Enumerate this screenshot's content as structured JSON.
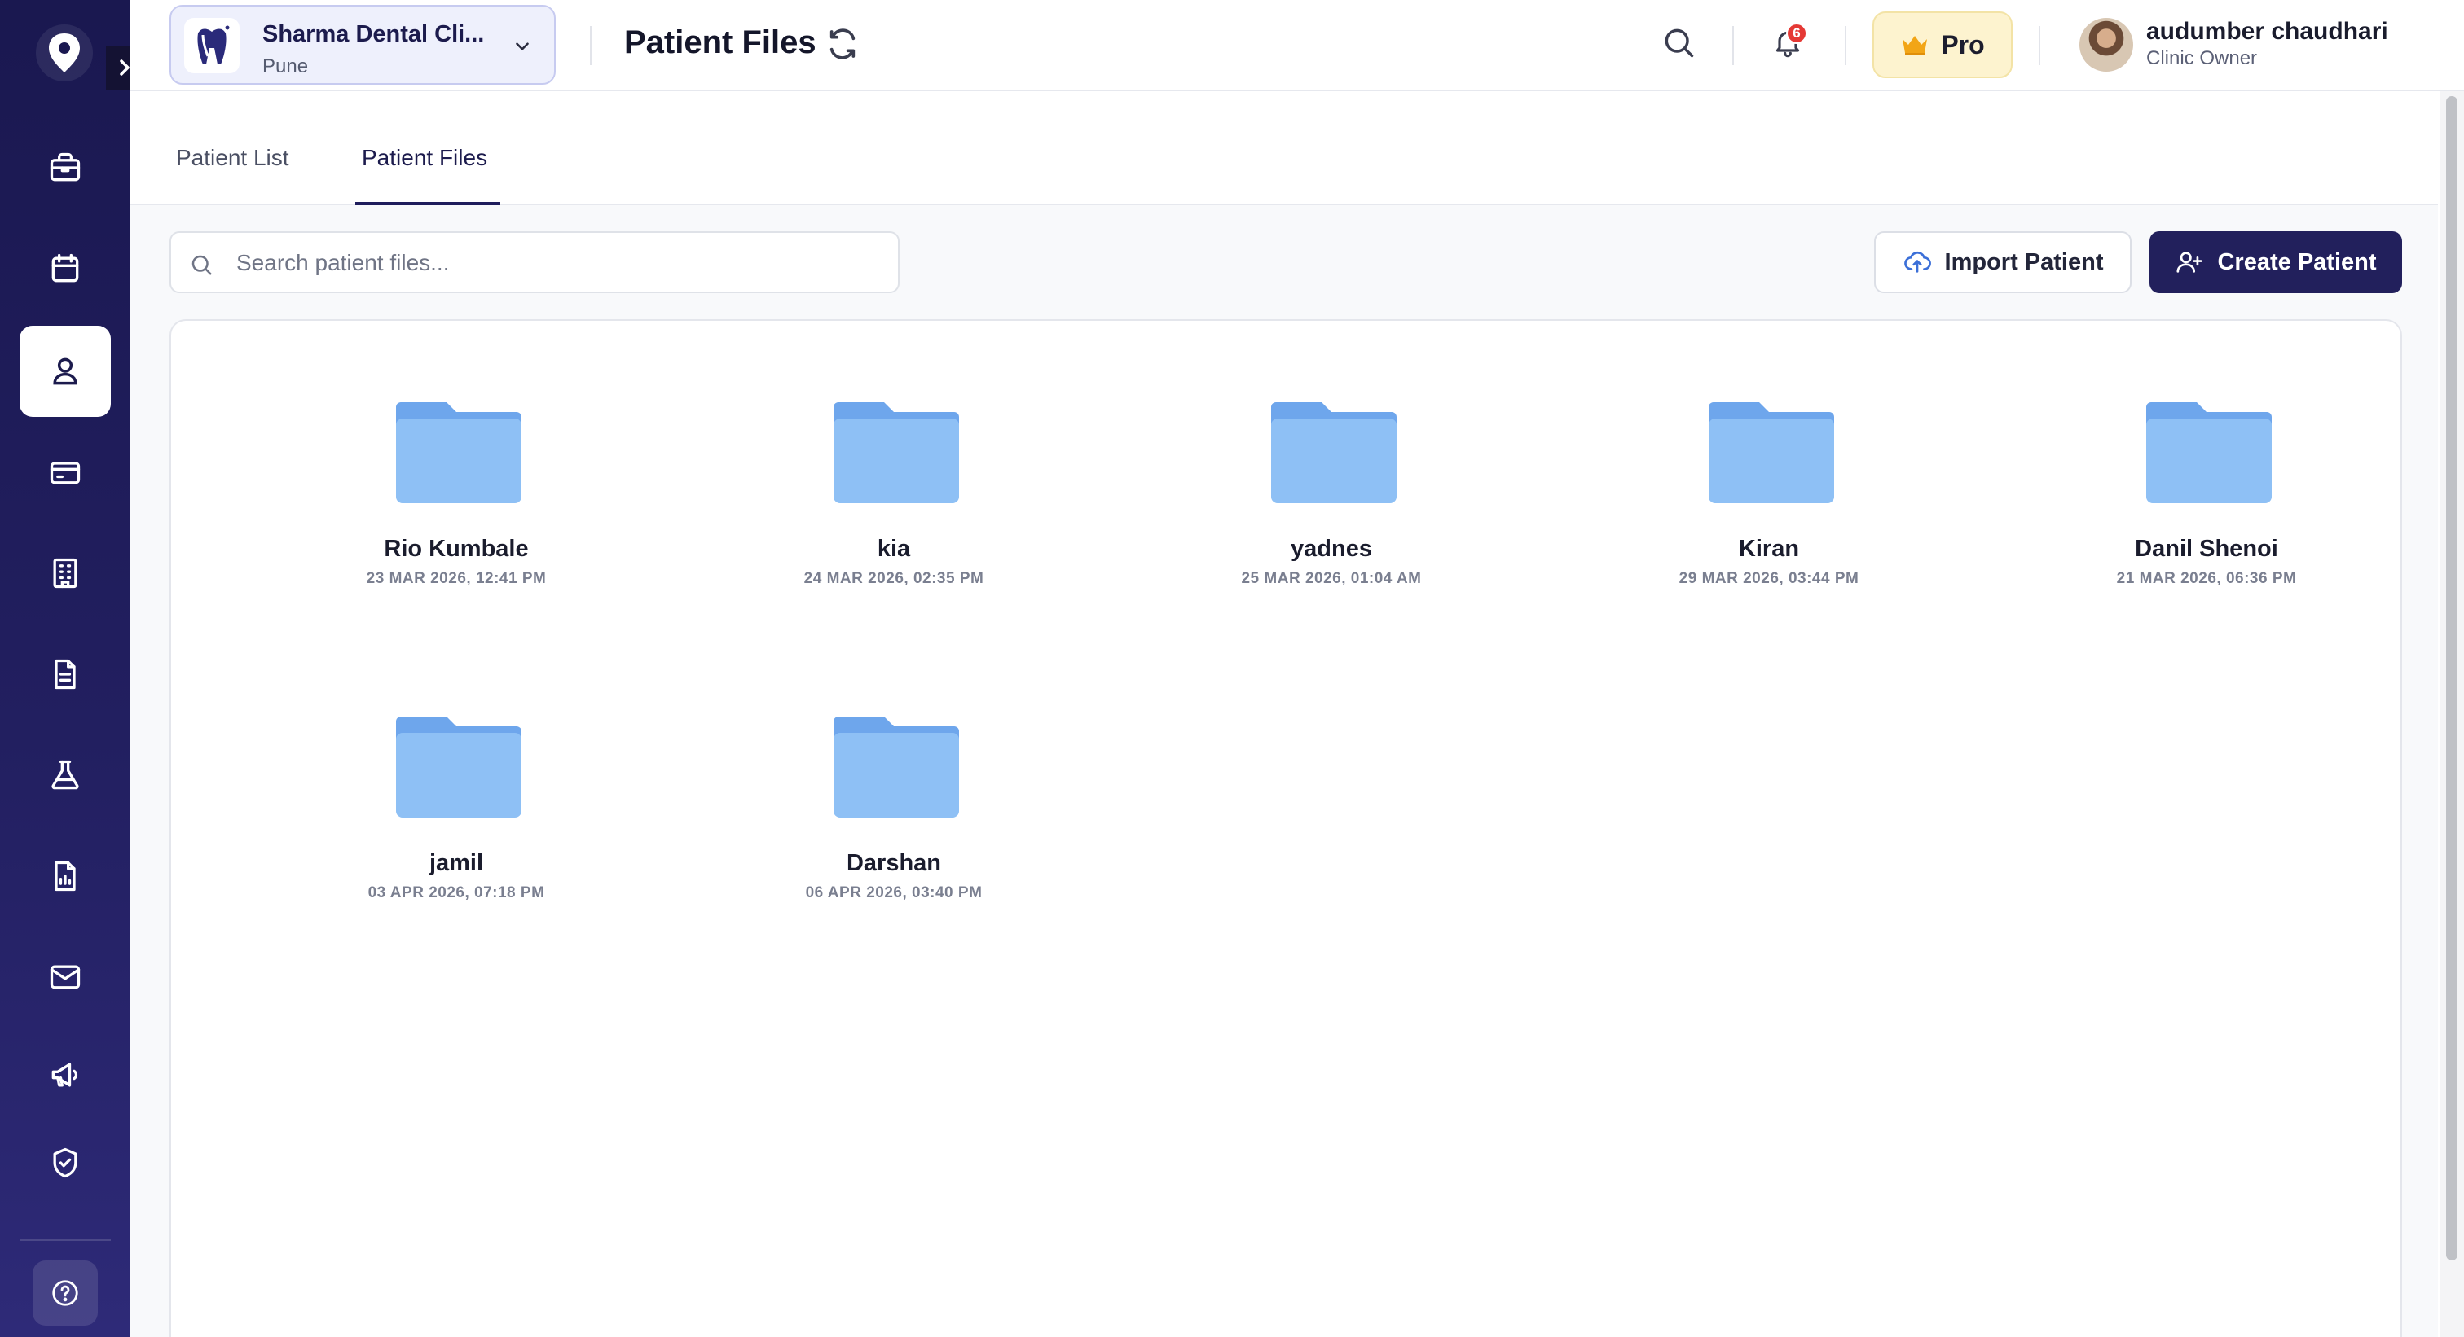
{
  "header": {
    "clinic_name": "Sharma Dental Cli...",
    "clinic_city": "Pune",
    "page_title": "Patient Files",
    "notification_count": "6",
    "pro_label": "Pro",
    "user_name": "audumber chaudhari",
    "user_role": "Clinic Owner"
  },
  "tabs": [
    {
      "label": "Patient List",
      "active": false
    },
    {
      "label": "Patient Files",
      "active": true
    }
  ],
  "search": {
    "placeholder": "Search patient files..."
  },
  "actions": {
    "import_label": "Import Patient",
    "create_label": "Create Patient"
  },
  "sidebar": {
    "items": [
      {
        "icon": "briefcase-icon",
        "active": false
      },
      {
        "icon": "calendar-icon",
        "active": false
      },
      {
        "icon": "user-icon",
        "active": true
      },
      {
        "icon": "billing-card-icon",
        "active": false
      },
      {
        "icon": "building-icon",
        "active": false
      },
      {
        "icon": "document-icon",
        "active": false
      },
      {
        "icon": "lab-flask-icon",
        "active": false
      },
      {
        "icon": "report-icon",
        "active": false
      },
      {
        "icon": "mail-icon",
        "active": false
      },
      {
        "icon": "megaphone-icon",
        "active": false
      },
      {
        "icon": "shield-check-icon",
        "active": false
      }
    ]
  },
  "files": [
    {
      "name": "Rio Kumbale",
      "date": "23 MAR 2026, 12:41 PM"
    },
    {
      "name": "kia",
      "date": "24 MAR 2026, 02:35 PM"
    },
    {
      "name": "yadnes",
      "date": "25 MAR 2026, 01:04 AM"
    },
    {
      "name": "Kiran",
      "date": "29 MAR 2026, 03:44 PM"
    },
    {
      "name": "Danil Shenoi",
      "date": "21 MAR 2026, 06:36 PM"
    },
    {
      "name": "jamil",
      "date": "03 APR 2026, 07:18 PM"
    },
    {
      "name": "Darshan",
      "date": "06 APR 2026, 03:40 PM"
    }
  ],
  "colors": {
    "sidebar": "#1a1850",
    "primary": "#22205c",
    "folder": "#7fb2ef",
    "badge": "#e53935",
    "pro_bg": "#fdf3cf"
  }
}
